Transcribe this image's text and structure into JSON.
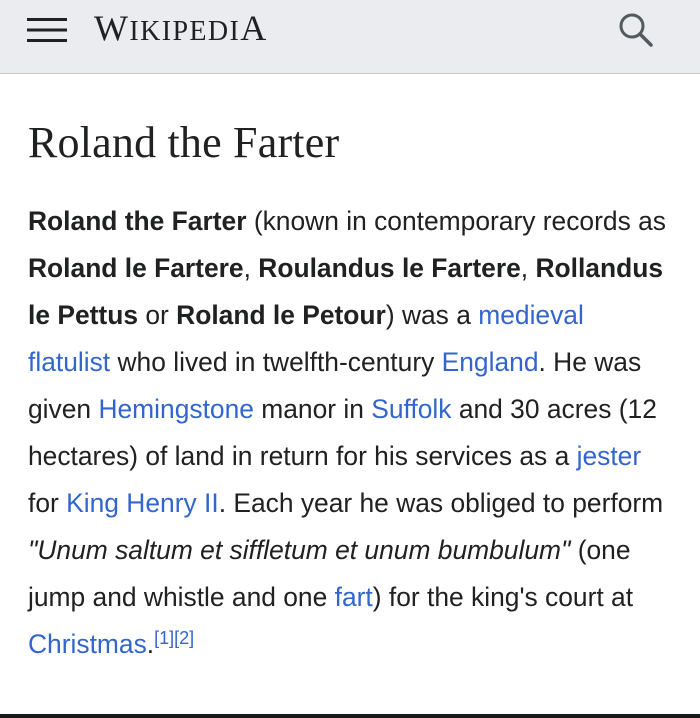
{
  "header": {
    "logo_first": "W",
    "logo_rest": "IKIPEDI",
    "logo_last": "A"
  },
  "article": {
    "title": "Roland the Farter",
    "p": {
      "s1": "Roland the Farter",
      "s2": " (known in contemporary records as ",
      "s3": "Roland le Fartere",
      "s4": ", ",
      "s5": "Roulandus le Fartere",
      "s6": ", ",
      "s7": "Rollandus le Pettus",
      "s8": " or ",
      "s9": "Roland le Petour",
      "s10": ") was a ",
      "link_flatulist": "medieval flatulist",
      "s11": " who lived in twelfth-century ",
      "link_england": "England",
      "s12": ". He was given ",
      "link_hemingstone": "Hemingstone",
      "s13": " manor in ",
      "link_suffolk": "Suffolk",
      "s14": " and 30 acres (12 hectares) of land in return for his services as a ",
      "link_jester": "jester",
      "s15": " for ",
      "link_henry": "King Henry II",
      "s16": ". Each year he was obliged to perform ",
      "quote": "\"Unum saltum et siffletum et unum bumbulum\"",
      "s17": " (one jump and whistle and one ",
      "link_fart": "fart",
      "s18": ") for the king's court at ",
      "link_christmas": "Christmas",
      "s19": ".",
      "ref1": "[1]",
      "ref2": "[2]"
    }
  }
}
